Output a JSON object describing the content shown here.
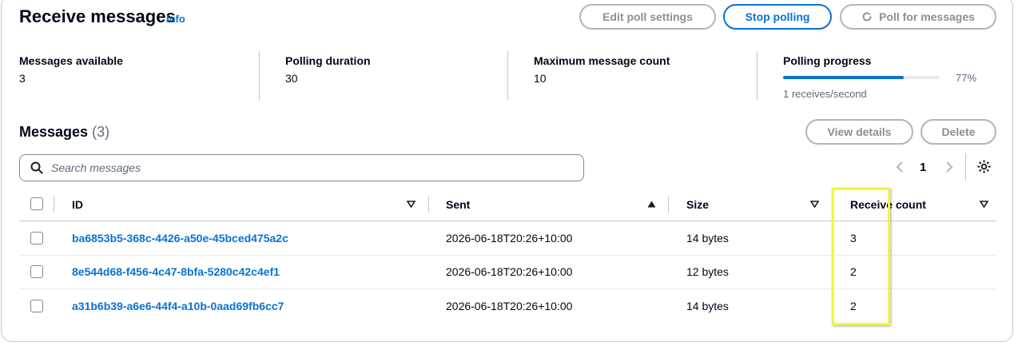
{
  "header": {
    "title": "Receive messages",
    "info_label": "Info",
    "edit_poll_label": "Edit poll settings",
    "stop_polling_label": "Stop polling",
    "poll_label": "Poll for messages"
  },
  "stats": {
    "messages_available": {
      "label": "Messages available",
      "value": "3"
    },
    "polling_duration": {
      "label": "Polling duration",
      "value": "30"
    },
    "max_message_count": {
      "label": "Maximum message count",
      "value": "10"
    },
    "polling_progress": {
      "label": "Polling progress",
      "percent_text": "77%",
      "fraction": 0.77,
      "rate": "1 receives/second"
    }
  },
  "messages": {
    "title": "Messages",
    "count": "(3)",
    "view_details_label": "View details",
    "delete_label": "Delete",
    "search_placeholder": "Search messages",
    "page_number": "1",
    "columns": [
      "ID",
      "Sent",
      "Size",
      "Receive count"
    ],
    "rows": [
      {
        "id": "ba6853b5-368c-4426-a50e-45bced475a2c",
        "sent": "2026-06-18T20:26+10:00",
        "size": "14 bytes",
        "receive_count": "3"
      },
      {
        "id": "8e544d68-f456-4c47-8bfa-5280c42c4ef1",
        "sent": "2026-06-18T20:26+10:00",
        "size": "12 bytes",
        "receive_count": "2"
      },
      {
        "id": "a31b6b39-a6e6-44f4-a10b-0aad69fb6cc7",
        "sent": "2026-06-18T20:26+10:00",
        "size": "14 bytes",
        "receive_count": "2"
      }
    ]
  },
  "colors": {
    "link": "#0972d3",
    "highlight": "#f4f542",
    "text": "#000716",
    "disabled": "#8d8d94"
  }
}
